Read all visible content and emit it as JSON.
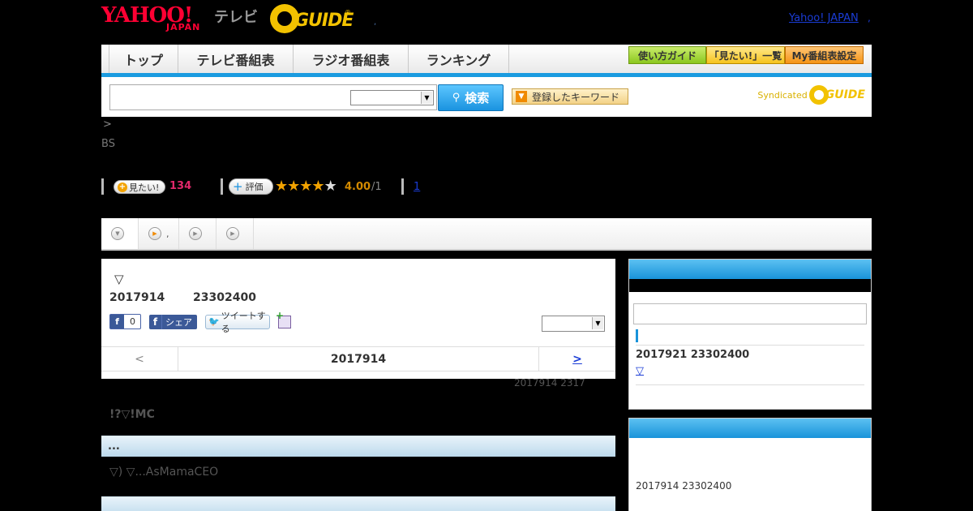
{
  "header": {
    "logo_yahoo": "YAHOO!",
    "logo_japan": "JAPAN",
    "logo_tv": "テレビ",
    "logo_gguide": "GUIDE",
    "logo_gguide_reg": "®",
    "dot": ",",
    "yahoo_japan_link": "Yahoo! JAPAN",
    "link_dot": ","
  },
  "nav": {
    "tabs": [
      "トップ",
      "テレビ番組表",
      "ラジオ番組表",
      "ランキング"
    ],
    "buttons": [
      "使い方ガイド",
      "「見たい!」一覧",
      "My番組表設定"
    ]
  },
  "search": {
    "button_label": "検索",
    "button_icon": "magnifier-icon",
    "keyword_button": "登録したキーワード",
    "syndicated_label": "Syndicated",
    "syndicated_logo": "GUIDE"
  },
  "breadcrumb": ">",
  "channel": "BS",
  "ratings": {
    "mitai_label": "見たい!",
    "mitai_count": "134",
    "hyoka_label": "評価",
    "stars_filled": 4,
    "stars_total": 5,
    "score": "4.00",
    "score_count": "/1",
    "comments_link": "1"
  },
  "tabstrip": {
    "tab2_text": ","
  },
  "program": {
    "marker": "▽",
    "date": "2017914",
    "time": "23302400",
    "fb_like_count": "0",
    "fb_share_label": "シェア",
    "tweet_label": "ツイートする",
    "nav_prev": "<",
    "nav_current": "2017914",
    "nav_next": ">",
    "updated": "2017914  2317",
    "title": "!?▽!MC",
    "section1_label": "...",
    "description": "▽) ▽...AsMamaCEO"
  },
  "side": {
    "next_date": "2017921  23302400",
    "next_link": "▽",
    "past_date": "2017914  23302400"
  },
  "colors": {
    "accent_blue": "#1a9be0",
    "yahoo_red": "#ff0033",
    "gguide_yellow": "#f2c200",
    "mitai_pink": "#e0286a",
    "star_orange": "#f3a300"
  }
}
